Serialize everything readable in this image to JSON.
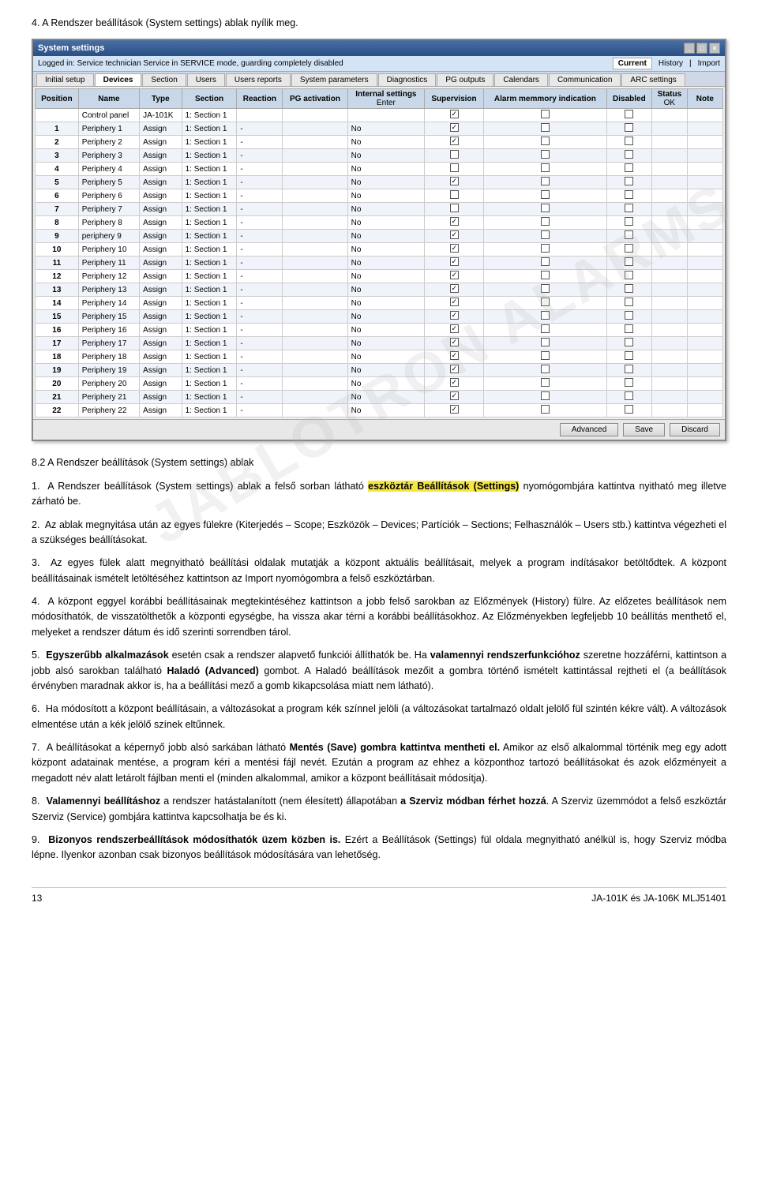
{
  "document": {
    "intro_text": "4. A Rendszer beállítások (System settings) ablak nyílik meg.",
    "section_heading": "8.2  A Rendszer beállítások (System settings) ablak",
    "paragraphs": [
      {
        "id": "p1",
        "text_before": "1.  A Rendszer beállítások (System settings) ablak a felső sorban látható ",
        "highlight": "eszköztár Beállítások (Settings)",
        "text_after": " nyomógombjára kattintva nyitható meg illetve zárható be."
      },
      {
        "id": "p2",
        "text": "2.  Az ablak megnyitása után az egyes fülekre (Kiterjedés – Scope; Eszközök – Devices; Partíciók – Sections; Felhasználók – Users stb.) kattintva végezheti el a szükséges beállításokat."
      },
      {
        "id": "p3",
        "text": "3.  Az egyes fülek alatt megnyitható beállítási oldalak mutatják a központ aktuális beállításait, melyek a program indításakor betöltődtek. A központ beállításainak ismételt letöltéséhez kattintson az Import nyomógombra a felső eszköztárban."
      },
      {
        "id": "p4",
        "text": "4.  A központ eggyel korábbi beállításainak megtekintéséhez kattintson a jobb felső sarokban az Előzmények (History) fülre. Az előzetes beállítások nem módosíthatók, de visszatölthetők a központi egységbe, ha vissza akar térni a korábbi beállításokhoz. Az Előzményekben legfeljebb 10 beállítás menthető el, melyeket a rendszer dátum és idő szerinti sorrendben tárol."
      },
      {
        "id": "p5",
        "text_before": "5.  ",
        "bold1": "Egyszerűbb alkalmazások",
        "text_mid1": " esetén csak a rendszer alapvető funkciói állíthatók be. Ha ",
        "bold2": "valamennyi rendszerfunkcióhoz",
        "text_mid2": " szeretne hozzáférni, kattintson a jobb alsó sarokban található ",
        "bold3": "Haladó (Advanced)",
        "text_after": " gombot. A Haladó beállítások mezőit a gombra történő ismételt kattintással rejtheti el (a beállítások érvényben maradnak akkor is, ha a beállítási mező a gomb kikapcsolása miatt nem látható)."
      },
      {
        "id": "p6",
        "text": "6.  Ha módosított a központ beállításain, a változásokat a program kék színnel jelöli (a változásokat tartalmazó oldalt jelölő fül szintén kékre vált). A változások elmentése után a kék jelölő színek eltűnnek."
      },
      {
        "id": "p7",
        "text_before": "7.  A beállításokat a képernyő jobb alsó sarkában látható ",
        "bold": "Mentés (Save) gombra kattintva mentheti el.",
        "text_after": " Amikor az első alkalommal történik meg egy adott központ adatainak mentése, a program kéri a mentési fájl nevét. Ezután a program az ehhez a központhoz tartozó beállításokat és azok előzményeit a megadott név alatt letárolt fájlban menti el (minden alkalommal, amikor a központ beállításait módosítja)."
      },
      {
        "id": "p8",
        "text_before": "8.  ",
        "bold1": "Valamennyi beállításhoz",
        "text_mid": " a rendszer hatástalanított (nem élesített) állapotában ",
        "bold2": "a Szerviz módban férhet hozzá",
        "text_after": ". A Szerviz üzemmódot a felső eszköztár Szerviz (Service) gombjára kattintva kapcsolhatja be és ki."
      },
      {
        "id": "p9",
        "text_before": "9.  ",
        "bold": "Bizonyos rendszerbeállítások módosíthatók üzem közben is.",
        "text_after": " Ezért a Beállítások (Settings) fül oldala megnyitható anélkül is, hogy Szerviz módba lépne. Ilyenkor azonban csak bizonyos beállítások módosítására van lehetőség."
      }
    ],
    "footer_page": "13",
    "footer_model": "JA-101K és JA-106K MLJ51401"
  },
  "window": {
    "title": "System settings",
    "status_text": "Logged in: Service technician Service in SERVICE mode, guarding completely disabled",
    "current_btn": "Current",
    "history_btn": "History",
    "import_btn": "Import",
    "tabs": [
      {
        "label": "Initial setup",
        "active": false
      },
      {
        "label": "Devices",
        "active": true
      },
      {
        "label": "Section",
        "active": false
      },
      {
        "label": "Users",
        "active": false
      },
      {
        "label": "Users reports",
        "active": false
      },
      {
        "label": "System parameters",
        "active": false
      },
      {
        "label": "Diagnostics",
        "active": false
      },
      {
        "label": "PG outputs",
        "active": false
      },
      {
        "label": "Calendars",
        "active": false
      },
      {
        "label": "Communication",
        "active": false
      },
      {
        "label": "ARC settings",
        "active": false
      }
    ],
    "table": {
      "headers": [
        "Position",
        "Name",
        "Type",
        "Section",
        "Reaction",
        "PG activation",
        "Internal settings",
        "Supervision",
        "Alarm memmory indication",
        "Disabled",
        "Status",
        "Note"
      ],
      "special_header_col7": "Enter",
      "special_header_col11": "OK",
      "rows": [
        {
          "pos": "",
          "name": "Control panel",
          "type": "JA-101K",
          "section": "1: Section 1",
          "reaction": "",
          "pg": "",
          "internal": "",
          "supervision": "✓",
          "alarm": "",
          "disabled": "",
          "status": "",
          "note": ""
        },
        {
          "pos": "1",
          "name": "Periphery 1",
          "type": "Assign",
          "section": "1: Section 1",
          "reaction": "-",
          "pg": "",
          "internal": "No",
          "supervision": "✓",
          "alarm": "",
          "disabled": "",
          "status": "",
          "note": ""
        },
        {
          "pos": "2",
          "name": "Periphery 2",
          "type": "Assign",
          "section": "1: Section 1",
          "reaction": "-",
          "pg": "",
          "internal": "No",
          "supervision": "✓",
          "alarm": "",
          "disabled": "",
          "status": "",
          "note": ""
        },
        {
          "pos": "3",
          "name": "Periphery 3",
          "type": "Assign",
          "section": "1: Section 1",
          "reaction": "-",
          "pg": "",
          "internal": "No",
          "supervision": "",
          "alarm": "",
          "disabled": "",
          "status": "",
          "note": ""
        },
        {
          "pos": "4",
          "name": "Periphery 4",
          "type": "Assign",
          "section": "1: Section 1",
          "reaction": "-",
          "pg": "",
          "internal": "No",
          "supervision": "",
          "alarm": "",
          "disabled": "",
          "status": "",
          "note": ""
        },
        {
          "pos": "5",
          "name": "Periphery 5",
          "type": "Assign",
          "section": "1: Section 1",
          "reaction": "-",
          "pg": "",
          "internal": "No",
          "supervision": "✓",
          "alarm": "",
          "disabled": "",
          "status": "",
          "note": ""
        },
        {
          "pos": "6",
          "name": "Periphery 6",
          "type": "Assign",
          "section": "1: Section 1",
          "reaction": "-",
          "pg": "",
          "internal": "No",
          "supervision": "",
          "alarm": "",
          "disabled": "",
          "status": "",
          "note": ""
        },
        {
          "pos": "7",
          "name": "Periphery 7",
          "type": "Assign",
          "section": "1: Section 1",
          "reaction": "-",
          "pg": "",
          "internal": "No",
          "supervision": "",
          "alarm": "",
          "disabled": "",
          "status": "",
          "note": ""
        },
        {
          "pos": "8",
          "name": "Periphery 8",
          "type": "Assign",
          "section": "1: Section 1",
          "reaction": "-",
          "pg": "",
          "internal": "No",
          "supervision": "✓",
          "alarm": "",
          "disabled": "",
          "status": "",
          "note": ""
        },
        {
          "pos": "9",
          "name": "periphery 9",
          "type": "Assign",
          "section": "1: Section 1",
          "reaction": "-",
          "pg": "",
          "internal": "No",
          "supervision": "✓",
          "alarm": "",
          "disabled": "",
          "status": "",
          "note": ""
        },
        {
          "pos": "10",
          "name": "Periphery 10",
          "type": "Assign",
          "section": "1: Section 1",
          "reaction": "-",
          "pg": "",
          "internal": "No",
          "supervision": "✓",
          "alarm": "",
          "disabled": "",
          "status": "",
          "note": ""
        },
        {
          "pos": "11",
          "name": "Periphery 11",
          "type": "Assign",
          "section": "1: Section 1",
          "reaction": "-",
          "pg": "",
          "internal": "No",
          "supervision": "✓",
          "alarm": "",
          "disabled": "",
          "status": "",
          "note": ""
        },
        {
          "pos": "12",
          "name": "Periphery 12",
          "type": "Assign",
          "section": "1: Section 1",
          "reaction": "-",
          "pg": "",
          "internal": "No",
          "supervision": "✓",
          "alarm": "",
          "disabled": "",
          "status": "",
          "note": ""
        },
        {
          "pos": "13",
          "name": "Periphery 13",
          "type": "Assign",
          "section": "1: Section 1",
          "reaction": "-",
          "pg": "",
          "internal": "No",
          "supervision": "✓",
          "alarm": "",
          "disabled": "",
          "status": "",
          "note": ""
        },
        {
          "pos": "14",
          "name": "Periphery 14",
          "type": "Assign",
          "section": "1: Section 1",
          "reaction": "-",
          "pg": "",
          "internal": "No",
          "supervision": "✓",
          "alarm": "",
          "disabled": "",
          "status": "",
          "note": ""
        },
        {
          "pos": "15",
          "name": "Periphery 15",
          "type": "Assign",
          "section": "1: Section 1",
          "reaction": "-",
          "pg": "",
          "internal": "No",
          "supervision": "✓",
          "alarm": "",
          "disabled": "",
          "status": "",
          "note": ""
        },
        {
          "pos": "16",
          "name": "Periphery 16",
          "type": "Assign",
          "section": "1: Section 1",
          "reaction": "-",
          "pg": "",
          "internal": "No",
          "supervision": "✓",
          "alarm": "",
          "disabled": "",
          "status": "",
          "note": ""
        },
        {
          "pos": "17",
          "name": "Periphery 17",
          "type": "Assign",
          "section": "1: Section 1",
          "reaction": "-",
          "pg": "",
          "internal": "No",
          "supervision": "✓",
          "alarm": "",
          "disabled": "",
          "status": "",
          "note": ""
        },
        {
          "pos": "18",
          "name": "Periphery 18",
          "type": "Assign",
          "section": "1: Section 1",
          "reaction": "-",
          "pg": "",
          "internal": "No",
          "supervision": "✓",
          "alarm": "",
          "disabled": "",
          "status": "",
          "note": ""
        },
        {
          "pos": "19",
          "name": "Periphery 19",
          "type": "Assign",
          "section": "1: Section 1",
          "reaction": "-",
          "pg": "",
          "internal": "No",
          "supervision": "✓",
          "alarm": "",
          "disabled": "",
          "status": "",
          "note": ""
        },
        {
          "pos": "20",
          "name": "Periphery 20",
          "type": "Assign",
          "section": "1: Section 1",
          "reaction": "-",
          "pg": "",
          "internal": "No",
          "supervision": "✓",
          "alarm": "",
          "disabled": "",
          "status": "",
          "note": ""
        },
        {
          "pos": "21",
          "name": "Periphery 21",
          "type": "Assign",
          "section": "1: Section 1",
          "reaction": "-",
          "pg": "",
          "internal": "No",
          "supervision": "✓",
          "alarm": "",
          "disabled": "",
          "status": "",
          "note": ""
        },
        {
          "pos": "22",
          "name": "Periphery 22",
          "type": "Assign",
          "section": "1: Section 1",
          "reaction": "-",
          "pg": "",
          "internal": "No",
          "supervision": "✓",
          "alarm": "",
          "disabled": "",
          "status": "",
          "note": ""
        }
      ],
      "action_buttons": [
        "Advanced",
        "Save",
        "Discard"
      ]
    }
  }
}
